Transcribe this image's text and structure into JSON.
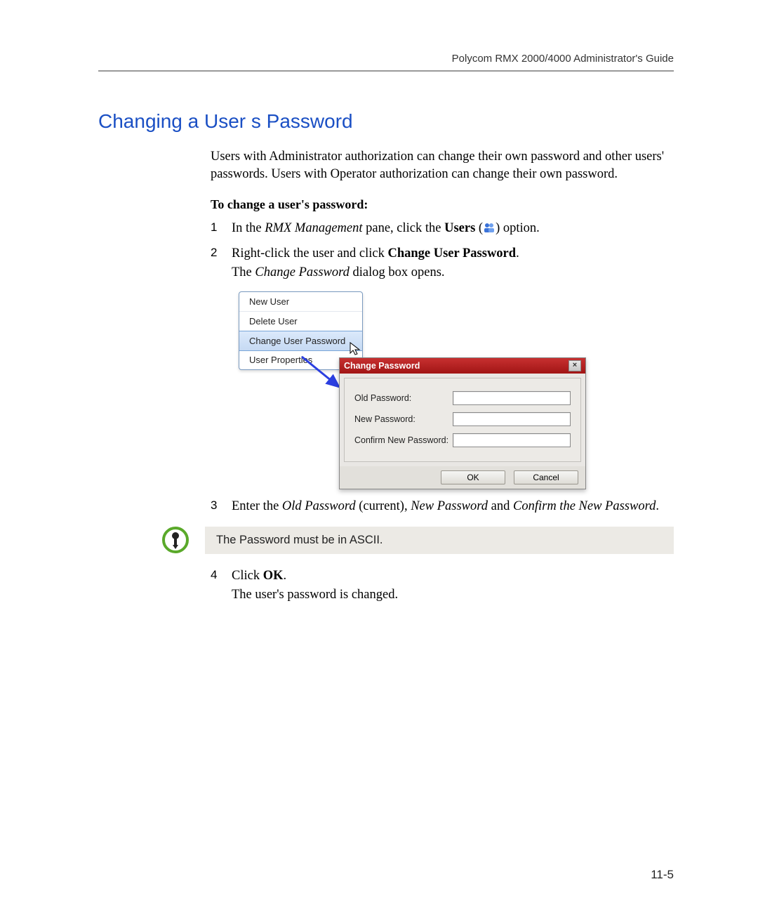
{
  "header": {
    "guide_title": "Polycom RMX 2000/4000 Administrator's Guide"
  },
  "title": "Changing a User s Password",
  "intro": "Users with Administrator authorization can change their own password and other users' passwords. Users with Operator authorization can change their own password.",
  "subhead": "To change a user's password:",
  "steps": {
    "s1_pre": "In the ",
    "s1_em1": "RMX Management",
    "s1_mid": " pane, click the ",
    "s1_b1": "Users",
    "s1_post": " (",
    "s1_end": ") option.",
    "s2_pre": "Right-click the user and click ",
    "s2_b1": "Change User Password",
    "s2_post": ".",
    "s2_line2_pre": "The ",
    "s2_line2_em": "Change Password",
    "s2_line2_post": " dialog box opens.",
    "s3_pre": "Enter the ",
    "s3_em1": "Old Password",
    "s3_mid1": " (current), ",
    "s3_em2": "New Password",
    "s3_mid2": " and ",
    "s3_em3": "Confirm the New Password",
    "s3_post": ".",
    "s4_pre": "Click ",
    "s4_b1": "OK",
    "s4_post": ".",
    "s4_line2": "The user's password is changed."
  },
  "context_menu": {
    "items": [
      "New User",
      "Delete User",
      "Change User Password",
      "User Properties"
    ],
    "selected_index": 2
  },
  "dialog": {
    "title": "Change Password",
    "fields": {
      "old": "Old Password:",
      "new": "New Password:",
      "confirm": "Confirm New Password:"
    },
    "buttons": {
      "ok": "OK",
      "cancel": "Cancel"
    }
  },
  "note": {
    "text": "The Password must be in ASCII."
  },
  "page_number": "11-5",
  "step_numbers": {
    "n1": "1",
    "n2": "2",
    "n3": "3",
    "n4": "4"
  }
}
